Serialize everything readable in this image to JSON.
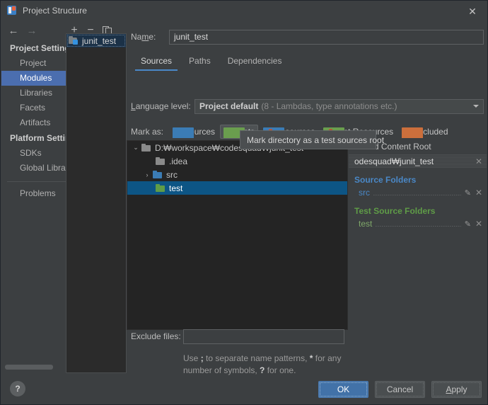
{
  "window": {
    "title": "Project Structure",
    "app_icon": "intellij-idea-icon",
    "close_label": "✕"
  },
  "toolbar": {
    "back": "←",
    "forward": "→",
    "add": "+",
    "remove": "−",
    "copy": "copy-icon"
  },
  "sidebar": {
    "groups": [
      {
        "header": "Project Settings",
        "items": [
          {
            "label": "Project",
            "selected": false
          },
          {
            "label": "Modules",
            "selected": true
          },
          {
            "label": "Libraries",
            "selected": false
          },
          {
            "label": "Facets",
            "selected": false
          },
          {
            "label": "Artifacts",
            "selected": false
          }
        ]
      },
      {
        "header": "Platform Settings",
        "items": [
          {
            "label": "SDKs",
            "selected": false
          },
          {
            "label": "Global Libraries",
            "selected": false
          }
        ]
      }
    ],
    "problems": "Problems",
    "help": "?"
  },
  "module_list": {
    "items": [
      {
        "label": "junit_test",
        "selected": true
      }
    ]
  },
  "main": {
    "name_label": "Name:",
    "name_label_pre": "Na",
    "name_label_accel": "m",
    "name_label_post": "e:",
    "name_value": "junit_test",
    "tabs": [
      {
        "label": "Sources",
        "active": true
      },
      {
        "label": "Paths",
        "active": false
      },
      {
        "label": "Dependencies",
        "active": false
      }
    ],
    "language_level_label_accel": "L",
    "language_level_label_post": "anguage level:",
    "language_level_value": "Project default",
    "language_level_detail": "(8 - Lambdas, type annotations etc.)",
    "mark_as_label": "Mark as:",
    "mark_buttons": [
      {
        "label_accel": "S",
        "label_post": "ources",
        "icon": "blue-folder-icon",
        "pressed": false
      },
      {
        "label_accel": "T",
        "label_post": "ests",
        "icon": "green-folder-icon",
        "pressed": true
      },
      {
        "label_accel": "R",
        "label_post": "esources",
        "icon": "resources-folder-icon",
        "pressed": false
      },
      {
        "label_accel": "T",
        "label_post": "est Resources",
        "icon": "test-resources-folder-icon",
        "pressed": false
      },
      {
        "label_accel": "E",
        "label_post": "xcluded",
        "icon": "orange-folder-icon",
        "pressed": false
      }
    ]
  },
  "tree": {
    "nodes": [
      {
        "label": "D:₩workspace₩codesquad₩junit_test",
        "indent": 0,
        "twisty": "⌄",
        "folder": "grey",
        "selected": false
      },
      {
        "label": ".idea",
        "indent": 1,
        "twisty": "",
        "folder": "grey",
        "selected": false
      },
      {
        "label": "src",
        "indent": 1,
        "twisty": "›",
        "folder": "blue",
        "selected": false
      },
      {
        "label": "test",
        "indent": 1,
        "twisty": "",
        "folder": "green",
        "selected": true
      }
    ]
  },
  "tooltip": {
    "text": "Mark directory as a test sources root"
  },
  "detail": {
    "add_content_root_plus": "+",
    "add_content_root_label": "Add Content Root",
    "content_root_path": "odesquad₩junit_test",
    "content_root_remove": "✕",
    "sections": [
      {
        "title": "Source Folders",
        "kind": "src",
        "rows": [
          {
            "name": "src",
            "edit": "✎",
            "remove": "✕"
          }
        ]
      },
      {
        "title": "Test Source Folders",
        "kind": "test",
        "rows": [
          {
            "name": "test",
            "edit": "✎",
            "remove": "✕"
          }
        ]
      }
    ]
  },
  "exclude": {
    "label": "Exclude files:",
    "value": "",
    "placeholder": "",
    "hint_line1_a": "Use ",
    "hint_line1_semicolon": ";",
    "hint_line1_b": " to separate name patterns, ",
    "hint_line1_star": "*",
    "hint_line1_c": " for any",
    "hint_line2_a": "number of symbols, ",
    "hint_line2_q": "?",
    "hint_line2_b": " for one."
  },
  "footer": {
    "ok": "OK",
    "cancel": "Cancel",
    "apply_accel": "A",
    "apply_post": "pply"
  },
  "colors": {
    "accent": "#4a88c7",
    "selection": "#4b6eaf",
    "tree_selection": "#0d5585",
    "primary_button": "#4272a8",
    "source_folder": "#4a88c7",
    "test_folder": "#5f9c47",
    "background": "#3c3f41",
    "tree_background": "#242424"
  }
}
